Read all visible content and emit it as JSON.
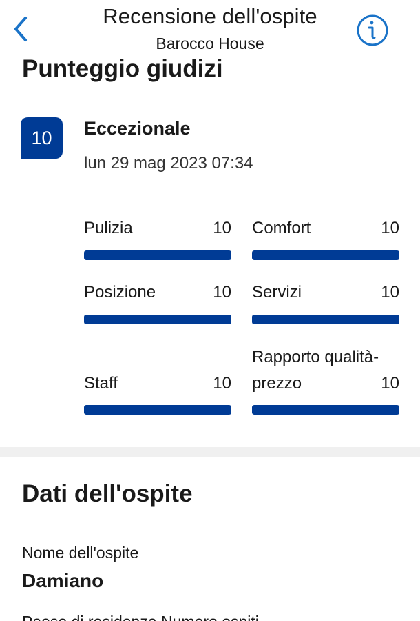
{
  "header": {
    "title": "Recensione dell'ospite",
    "subtitle": "Barocco House",
    "back_icon": "chevron-left-icon",
    "info_icon": "info-circle-icon",
    "accent_color": "#1a73c8"
  },
  "scores": {
    "title": "Punteggio giudizi",
    "overall": "10",
    "overall_word": "Eccezionale",
    "date": "lun 29 mag 2023 07:34",
    "badge_color": "#003b95",
    "categories": [
      {
        "label": "Pulizia",
        "value": "10",
        "fraction": 1.0
      },
      {
        "label": "Comfort",
        "value": "10",
        "fraction": 1.0
      },
      {
        "label": "Posizione",
        "value": "10",
        "fraction": 1.0
      },
      {
        "label": "Servizi",
        "value": "10",
        "fraction": 1.0
      },
      {
        "label": "Staff",
        "value": "10",
        "fraction": 1.0
      },
      {
        "label": "Rapporto qualità-prezzo",
        "value": "10",
        "fraction": 1.0
      }
    ]
  },
  "guest": {
    "title": "Dati dell'ospite",
    "name_label": "Nome dell'ospite",
    "name_value": "Damiano",
    "next_line": "Paese di residenza    Numero ospiti"
  }
}
